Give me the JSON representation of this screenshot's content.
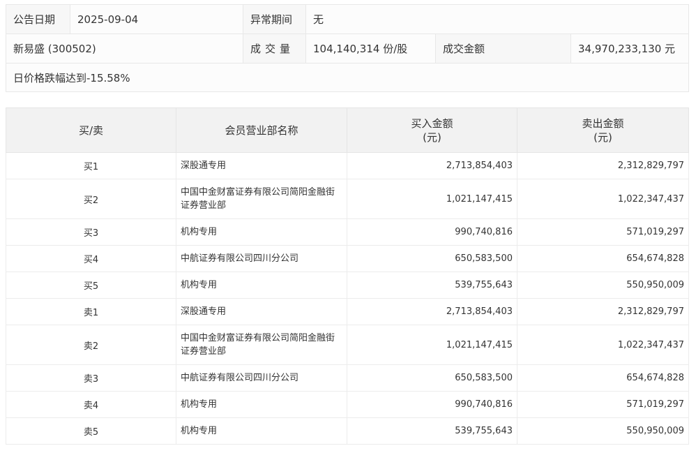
{
  "info": {
    "date_label": "公告日期",
    "date_value": "2025-09-04",
    "period_label": "异常期间",
    "period_value": "无",
    "stock_name": "新易盛 (300502)",
    "volume_label": "成交量",
    "volume_value": "104,140,314 份/股",
    "amount_label": "成交金额",
    "amount_value": "34,970,233,130 元",
    "reason": "日价格跌幅达到-15.58%"
  },
  "trade": {
    "headers": {
      "side": "买/卖",
      "broker": "会员营业部名称",
      "buy_line1": "买入金额",
      "buy_line2": "(元)",
      "sell_line1": "卖出金额",
      "sell_line2": "(元)"
    },
    "rows": [
      {
        "side": "买1",
        "broker": "深股通专用",
        "buy": "2,713,854,403",
        "sell": "2,312,829,797"
      },
      {
        "side": "买2",
        "broker": "中国中金财富证券有限公司简阳金融街证券营业部",
        "buy": "1,021,147,415",
        "sell": "1,022,347,437"
      },
      {
        "side": "买3",
        "broker": "机构专用",
        "buy": "990,740,816",
        "sell": "571,019,297"
      },
      {
        "side": "买4",
        "broker": "中航证券有限公司四川分公司",
        "buy": "650,583,500",
        "sell": "654,674,828"
      },
      {
        "side": "买5",
        "broker": "机构专用",
        "buy": "539,755,643",
        "sell": "550,950,009"
      },
      {
        "side": "卖1",
        "broker": "深股通专用",
        "buy": "2,713,854,403",
        "sell": "2,312,829,797"
      },
      {
        "side": "卖2",
        "broker": "中国中金财富证券有限公司简阳金融街证券营业部",
        "buy": "1,021,147,415",
        "sell": "1,022,347,437"
      },
      {
        "side": "卖3",
        "broker": "中航证券有限公司四川分公司",
        "buy": "650,583,500",
        "sell": "654,674,828"
      },
      {
        "side": "卖4",
        "broker": "机构专用",
        "buy": "990,740,816",
        "sell": "571,019,297"
      },
      {
        "side": "卖5",
        "broker": "机构专用",
        "buy": "539,755,643",
        "sell": "550,950,009"
      }
    ]
  }
}
